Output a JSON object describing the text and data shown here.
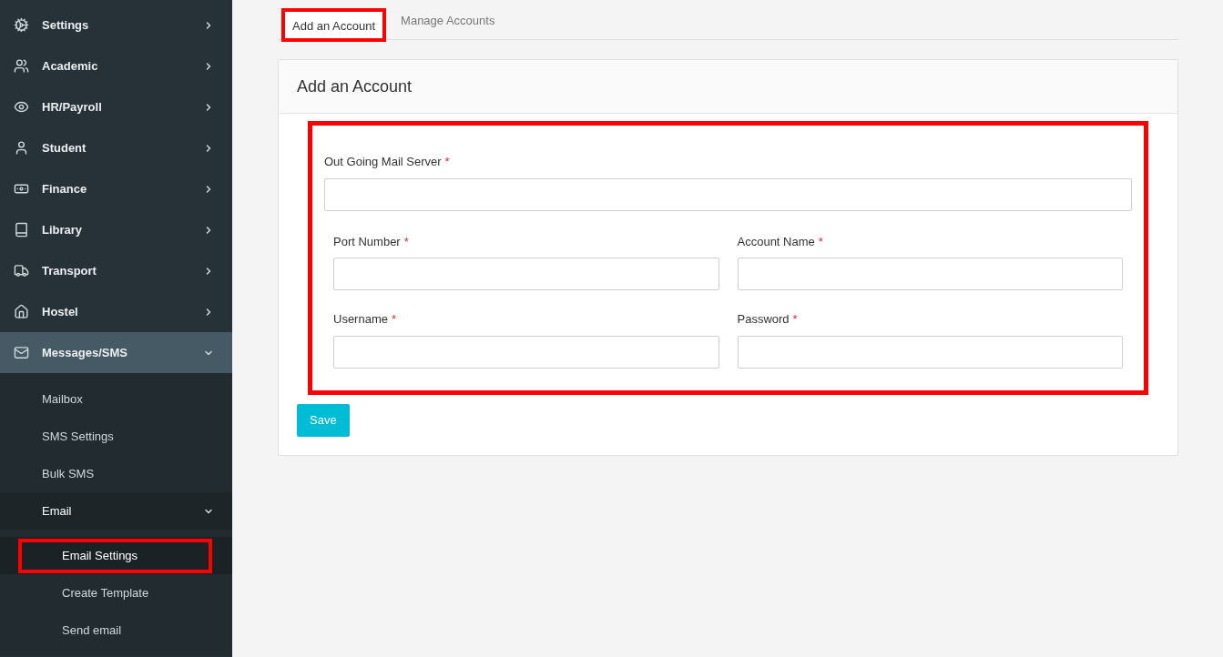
{
  "sidebar": {
    "items": [
      {
        "label": "Settings",
        "expanded": false
      },
      {
        "label": "Academic",
        "expanded": false
      },
      {
        "label": "HR/Payroll",
        "expanded": false
      },
      {
        "label": "Student",
        "expanded": false
      },
      {
        "label": "Finance",
        "expanded": false
      },
      {
        "label": "Library",
        "expanded": false
      },
      {
        "label": "Transport",
        "expanded": false
      },
      {
        "label": "Hostel",
        "expanded": false
      },
      {
        "label": "Messages/SMS",
        "expanded": true,
        "children": [
          {
            "label": "Mailbox",
            "expanded": false
          },
          {
            "label": "SMS Settings",
            "expanded": false
          },
          {
            "label": "Bulk SMS",
            "expanded": false
          },
          {
            "label": "Email",
            "expanded": true,
            "children": [
              {
                "label": "Email Settings",
                "selected": true,
                "highlighted": true
              },
              {
                "label": "Create Template",
                "selected": false,
                "highlighted": false
              },
              {
                "label": "Send email",
                "selected": false,
                "highlighted": false
              }
            ]
          }
        ]
      }
    ]
  },
  "tabs": [
    {
      "label": "Add an Account",
      "selected": true,
      "highlighted": true
    },
    {
      "label": "Manage Accounts",
      "selected": false,
      "highlighted": false
    }
  ],
  "panel": {
    "title": "Add an Account",
    "highlighted": true,
    "full_field": {
      "label": "Out Going Mail Server",
      "required_mark": "*"
    },
    "fields": [
      {
        "label": "Port Number",
        "required_mark": "*"
      },
      {
        "label": "Account Name",
        "required_mark": "*"
      },
      {
        "label": "Username",
        "required_mark": "*"
      },
      {
        "label": "Password",
        "required_mark": "*"
      }
    ],
    "save_button": "Save"
  }
}
